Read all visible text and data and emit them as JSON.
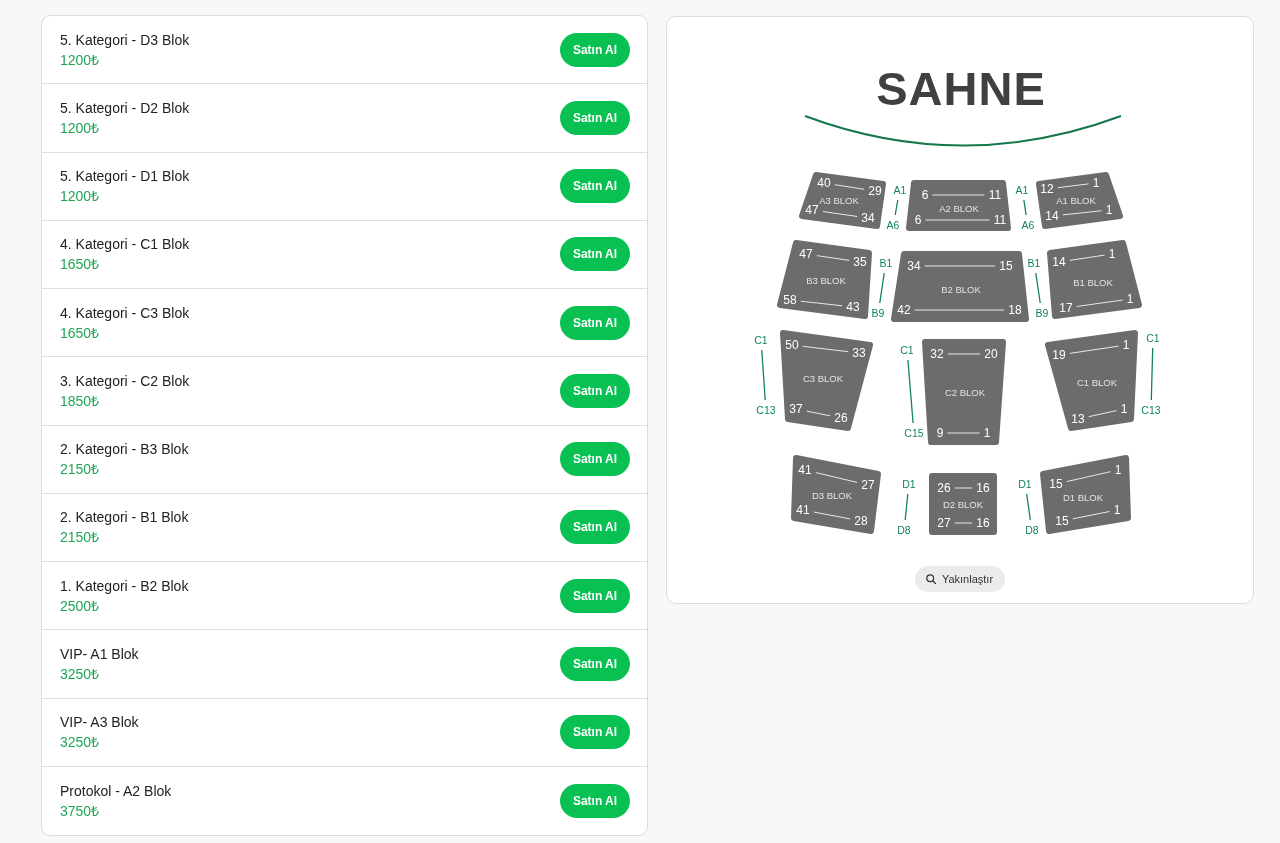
{
  "tickets": [
    {
      "title": "5. Kategori - D3 Blok",
      "price": "1200₺",
      "button": "Satın Al"
    },
    {
      "title": "5. Kategori - D2 Blok",
      "price": "1200₺",
      "button": "Satın Al"
    },
    {
      "title": "5. Kategori - D1 Blok",
      "price": "1200₺",
      "button": "Satın Al"
    },
    {
      "title": "4. Kategori - C1 Blok",
      "price": "1650₺",
      "button": "Satın Al"
    },
    {
      "title": "4. Kategori - C3 Blok",
      "price": "1650₺",
      "button": "Satın Al"
    },
    {
      "title": "3. Kategori - C2 Blok",
      "price": "1850₺",
      "button": "Satın Al"
    },
    {
      "title": "2. Kategori - B3 Blok",
      "price": "2150₺",
      "button": "Satın Al"
    },
    {
      "title": "2. Kategori - B1 Blok",
      "price": "2150₺",
      "button": "Satın Al"
    },
    {
      "title": "1. Kategori - B2 Blok",
      "price": "2500₺",
      "button": "Satın Al"
    },
    {
      "title": "VIP- A1 Blok",
      "price": "3250₺",
      "button": "Satın Al"
    },
    {
      "title": "VIP- A3 Blok",
      "price": "3250₺",
      "button": "Satın Al"
    },
    {
      "title": "Protokol - A2 Blok",
      "price": "3750₺",
      "button": "Satın Al"
    }
  ],
  "seat_map": {
    "stage_label": "SAHNE",
    "blocks": [
      {
        "label": "A3 BLOK",
        "rows": [
          {
            "first": "40",
            "last": "29"
          },
          {
            "first": "47",
            "last": "34"
          }
        ]
      },
      {
        "label": "A2 BLOK",
        "rows": [
          {
            "first": "6",
            "last": "11"
          },
          {
            "first": "6",
            "last": "11"
          }
        ]
      },
      {
        "label": "A1 BLOK",
        "rows": [
          {
            "first": "12",
            "last": "1"
          },
          {
            "first": "14",
            "last": "1"
          }
        ]
      },
      {
        "label": "B3 BLOK",
        "rows": [
          {
            "first": "47",
            "last": "35"
          },
          {
            "first": "58",
            "last": "43"
          }
        ]
      },
      {
        "label": "B2 BLOK",
        "rows": [
          {
            "first": "34",
            "last": "15"
          },
          {
            "first": "42",
            "last": "18"
          }
        ]
      },
      {
        "label": "B1 BLOK",
        "rows": [
          {
            "first": "14",
            "last": "1"
          },
          {
            "first": "17",
            "last": "1"
          }
        ]
      },
      {
        "label": "C3 BLOK",
        "rows": [
          {
            "first": "50",
            "last": "33"
          },
          {
            "first": "37",
            "last": "26"
          }
        ]
      },
      {
        "label": "C2 BLOK",
        "rows": [
          {
            "first": "32",
            "last": "20"
          },
          {
            "first": "9",
            "last": "1"
          }
        ]
      },
      {
        "label": "C1 BLOK",
        "rows": [
          {
            "first": "19",
            "last": "1"
          },
          {
            "first": "13",
            "last": "1"
          }
        ]
      },
      {
        "label": "D3 BLOK",
        "rows": [
          {
            "first": "41",
            "last": "27"
          },
          {
            "first": "41",
            "last": "28"
          }
        ]
      },
      {
        "label": "D2 BLOK",
        "rows": [
          {
            "first": "26",
            "last": "16"
          },
          {
            "first": "27",
            "last": "16"
          }
        ]
      },
      {
        "label": "D1 BLOK",
        "rows": [
          {
            "first": "15",
            "last": "1"
          },
          {
            "first": "15",
            "last": "1"
          }
        ]
      }
    ],
    "row_markers": [
      {
        "first": "A1",
        "last": "A6"
      },
      {
        "first": "A1",
        "last": "A6"
      },
      {
        "first": "B1",
        "last": "B9"
      },
      {
        "first": "B1",
        "last": "B9"
      },
      {
        "first": "C1",
        "last": "C13"
      },
      {
        "first": "C1",
        "last": "C15"
      },
      {
        "first": "C1",
        "last": "C13"
      },
      {
        "first": "D1",
        "last": "D8"
      },
      {
        "first": "D1",
        "last": "D8"
      }
    ],
    "zoom_button": "Yakınlaştır"
  }
}
